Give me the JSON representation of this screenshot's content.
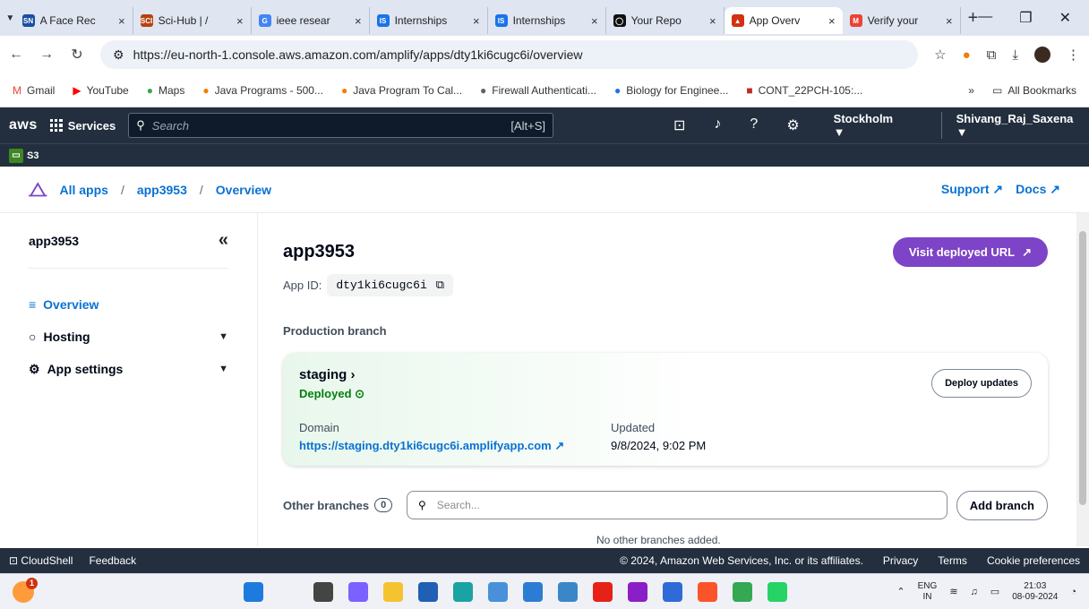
{
  "tabs": [
    {
      "fav": "SN",
      "favColor": "#1a4fa0",
      "title": "A Face Rec"
    },
    {
      "fav": "SCI",
      "favColor": "#b7410e",
      "title": "Sci-Hub | /"
    },
    {
      "fav": "G",
      "favColor": "#4285f4",
      "title": "ieee resear"
    },
    {
      "fav": "IS",
      "favColor": "#1a73e8",
      "title": "Internships"
    },
    {
      "fav": "IS",
      "favColor": "#1a73e8",
      "title": "Internships"
    },
    {
      "fav": "◯",
      "favColor": "#111111",
      "title": "Your Repo"
    },
    {
      "fav": "▲",
      "favColor": "#d13212",
      "title": "App Overv"
    },
    {
      "fav": "M",
      "favColor": "#ea4335",
      "title": "Verify your"
    }
  ],
  "address": {
    "url": "https://eu-north-1.console.aws.amazon.com/amplify/apps/dty1ki6cugc6i/overview"
  },
  "bookmarks": [
    {
      "fav": "M",
      "color": "#ea4335",
      "label": "Gmail"
    },
    {
      "fav": "▶",
      "color": "#ff0000",
      "label": "YouTube"
    },
    {
      "fav": "●",
      "color": "#34a853",
      "label": "Maps"
    },
    {
      "fav": "●",
      "color": "#f57c00",
      "label": "Java Programs - 500..."
    },
    {
      "fav": "●",
      "color": "#f57c00",
      "label": "Java Program To Cal..."
    },
    {
      "fav": "●",
      "color": "#5f6368",
      "label": "Firewall Authenticati..."
    },
    {
      "fav": "●",
      "color": "#1a73e8",
      "label": "Biology for Enginee..."
    },
    {
      "fav": "■",
      "color": "#c62828",
      "label": "CONT_22PCH-105:..."
    }
  ],
  "bookmarks_more": "»",
  "all_bookmarks": "All Bookmarks",
  "aws": {
    "logo": "aws",
    "services": "Services",
    "search_placeholder": "Search",
    "search_shortcut": "[Alt+S]",
    "region": "Stockholm ▼",
    "user": "Shivang_Raj_Saxena ▼",
    "s3": "S3"
  },
  "breadcrumb": {
    "items": [
      "All apps",
      "app3953",
      "Overview"
    ],
    "sep": "/",
    "support": "Support",
    "docs": "Docs"
  },
  "sidebar": {
    "title": "app3953",
    "collapse": "«",
    "items": [
      {
        "label": "Overview",
        "icon": "≡"
      },
      {
        "label": "Hosting",
        "icon": "○"
      },
      {
        "label": "App settings",
        "icon": "⚙"
      }
    ]
  },
  "main": {
    "title": "app3953",
    "visit_label": "Visit deployed URL",
    "app_id_label": "App ID:",
    "app_id": "dty1ki6cugc6i",
    "production_label": "Production branch",
    "branch": "staging",
    "branch_status": "Deployed",
    "domain_label": "Domain",
    "domain": "https://staging.dty1ki6cugc6i.amplifyapp.com",
    "updated_label": "Updated",
    "updated": "9/8/2024, 9:02 PM",
    "deploy_label": "Deploy updates",
    "other_label": "Other branches",
    "other_count": "0",
    "search_placeholder": "Search...",
    "add_branch": "Add branch",
    "no_branches": "No other branches added."
  },
  "footer": {
    "cloudshell": "CloudShell",
    "feedback": "Feedback",
    "copyright": "© 2024, Amazon Web Services, Inc. or its affiliates.",
    "privacy": "Privacy",
    "terms": "Terms",
    "cookies": "Cookie preferences"
  },
  "taskbar": {
    "badge": "1",
    "apps": [
      {
        "name": "windows-start",
        "color": "#1f7ae0"
      },
      {
        "name": "search",
        "color": "#eff1f6"
      },
      {
        "name": "task-view",
        "color": "#444444"
      },
      {
        "name": "copilot",
        "color": "#7b61ff"
      },
      {
        "name": "file-explorer",
        "color": "#f4c430"
      },
      {
        "name": "store",
        "color": "#1f5fb4"
      },
      {
        "name": "edge",
        "color": "#1aa3a3"
      },
      {
        "name": "chatgpt",
        "color": "#4a90d9"
      },
      {
        "name": "vscode",
        "color": "#2b7cd3"
      },
      {
        "name": "mysql",
        "color": "#3a86c8"
      },
      {
        "name": "youtube",
        "color": "#e62117"
      },
      {
        "name": "jetbrains",
        "color": "#8a1fc7"
      },
      {
        "name": "mail",
        "color": "#2f6bd6"
      },
      {
        "name": "brave",
        "color": "#fb542b"
      },
      {
        "name": "chrome",
        "color": "#34a853"
      },
      {
        "name": "whatsapp",
        "color": "#25d366"
      }
    ],
    "lang_top": "ENG",
    "lang_bottom": "IN",
    "time": "21:03",
    "date": "08-09-2024"
  }
}
